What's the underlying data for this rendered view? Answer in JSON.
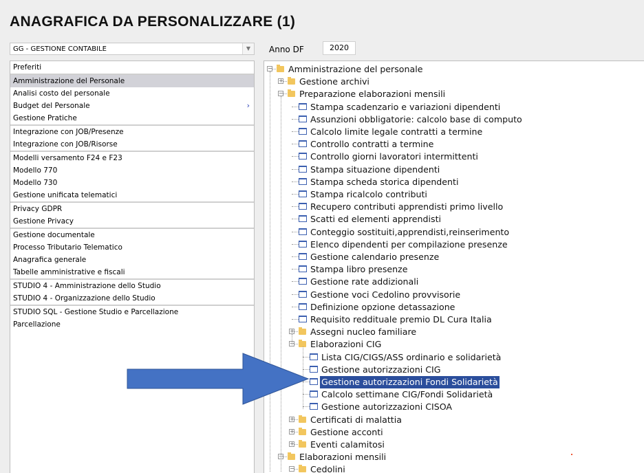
{
  "page": {
    "title": "ANAGRAFICA DA PERSONALIZZARE (1)"
  },
  "module_select": {
    "value": "GG - GESTIONE CONTABILE",
    "arrow_icon": "chevron-down-icon"
  },
  "year": {
    "label": "Anno DF",
    "value": "2020"
  },
  "menu": [
    {
      "label": "Preferiti",
      "sep": false,
      "selected": false,
      "chevron": false
    },
    {
      "label": "Amministrazione del Personale",
      "sep": true,
      "selected": true,
      "chevron": false
    },
    {
      "label": "Analisi costo del personale",
      "sep": false,
      "selected": false,
      "chevron": false
    },
    {
      "label": "Budget del Personale",
      "sep": false,
      "selected": false,
      "chevron": true
    },
    {
      "label": "Gestione Pratiche",
      "sep": false,
      "selected": false,
      "chevron": false
    },
    {
      "label": "Integrazione con JOB/Presenze",
      "sep": true,
      "selected": false,
      "chevron": false
    },
    {
      "label": "Integrazione con JOB/Risorse",
      "sep": false,
      "selected": false,
      "chevron": false
    },
    {
      "label": "Modelli versamento F24 e F23",
      "sep": true,
      "selected": false,
      "chevron": false
    },
    {
      "label": "Modello 770",
      "sep": false,
      "selected": false,
      "chevron": false
    },
    {
      "label": "Modello 730",
      "sep": false,
      "selected": false,
      "chevron": false
    },
    {
      "label": "Gestione unificata telematici",
      "sep": false,
      "selected": false,
      "chevron": false
    },
    {
      "label": "Privacy GDPR",
      "sep": true,
      "selected": false,
      "chevron": false
    },
    {
      "label": "Gestione Privacy",
      "sep": false,
      "selected": false,
      "chevron": false
    },
    {
      "label": "Gestione documentale",
      "sep": true,
      "selected": false,
      "chevron": false
    },
    {
      "label": "Processo Tributario Telematico",
      "sep": false,
      "selected": false,
      "chevron": false
    },
    {
      "label": "Anagrafica generale",
      "sep": false,
      "selected": false,
      "chevron": false
    },
    {
      "label": "Tabelle amministrative e fiscali",
      "sep": false,
      "selected": false,
      "chevron": false
    },
    {
      "label": "STUDIO 4 - Amministrazione dello Studio",
      "sep": true,
      "selected": false,
      "chevron": false
    },
    {
      "label": "STUDIO 4 - Organizzazione dello Studio",
      "sep": false,
      "selected": false,
      "chevron": false
    },
    {
      "label": "STUDIO SQL - Gestione Studio e Parcellazione",
      "sep": true,
      "selected": false,
      "chevron": false
    },
    {
      "label": "Parcellazione",
      "sep": false,
      "selected": false,
      "chevron": false
    }
  ],
  "tree": [
    {
      "label": "Amministrazione del personale",
      "level": 0,
      "kind": "folder",
      "expander": "-"
    },
    {
      "label": "Gestione archivi",
      "level": 1,
      "kind": "folder",
      "expander": "+"
    },
    {
      "label": "Preparazione elaborazioni mensili",
      "level": 1,
      "kind": "folder",
      "expander": "-"
    },
    {
      "label": "Stampa scadenzario e variazioni dipendenti",
      "level": 2,
      "kind": "doc"
    },
    {
      "label": "Assunzioni obbligatorie: calcolo base di computo",
      "level": 2,
      "kind": "doc"
    },
    {
      "label": "Calcolo limite legale contratti a termine",
      "level": 2,
      "kind": "doc"
    },
    {
      "label": "Controllo contratti a termine",
      "level": 2,
      "kind": "doc"
    },
    {
      "label": "Controllo giorni lavoratori intermittenti",
      "level": 2,
      "kind": "doc"
    },
    {
      "label": "Stampa situazione dipendenti",
      "level": 2,
      "kind": "doc"
    },
    {
      "label": "Stampa scheda storica dipendenti",
      "level": 2,
      "kind": "doc"
    },
    {
      "label": "Stampa ricalcolo contributi",
      "level": 2,
      "kind": "doc"
    },
    {
      "label": "Recupero contributi apprendisti primo livello",
      "level": 2,
      "kind": "doc"
    },
    {
      "label": "Scatti ed elementi apprendisti",
      "level": 2,
      "kind": "doc"
    },
    {
      "label": "Conteggio sostituiti,apprendisti,reinserimento",
      "level": 2,
      "kind": "doc"
    },
    {
      "label": "Elenco dipendenti per compilazione presenze",
      "level": 2,
      "kind": "doc"
    },
    {
      "label": "Gestione calendario presenze",
      "level": 2,
      "kind": "doc"
    },
    {
      "label": "Stampa libro presenze",
      "level": 2,
      "kind": "doc"
    },
    {
      "label": "Gestione rate addizionali",
      "level": 2,
      "kind": "doc"
    },
    {
      "label": "Gestione voci Cedolino provvisorie",
      "level": 2,
      "kind": "doc"
    },
    {
      "label": "Definizione opzione detassazione",
      "level": 2,
      "kind": "doc"
    },
    {
      "label": "Requisito reddituale premio DL Cura Italia",
      "level": 2,
      "kind": "doc"
    },
    {
      "label": "Assegni nucleo familiare",
      "level": 2,
      "kind": "folder",
      "expander": "+"
    },
    {
      "label": "Elaborazioni CIG",
      "level": 2,
      "kind": "folder",
      "expander": "-"
    },
    {
      "label": "Lista CIG/CIGS/ASS ordinario e solidarietà",
      "level": 3,
      "kind": "doc"
    },
    {
      "label": "Gestione autorizzazioni CIG",
      "level": 3,
      "kind": "doc"
    },
    {
      "label": "Gestione autorizzazioni Fondi Solidarietà",
      "level": 3,
      "kind": "doc",
      "selected": true
    },
    {
      "label": "Calcolo settimane CIG/Fondi Solidarietà",
      "level": 3,
      "kind": "doc"
    },
    {
      "label": "Gestione autorizzazioni CISOA",
      "level": 3,
      "kind": "doc"
    },
    {
      "label": "Certificati di malattia",
      "level": 2,
      "kind": "folder",
      "expander": "+"
    },
    {
      "label": "Gestione acconti",
      "level": 2,
      "kind": "folder",
      "expander": "+"
    },
    {
      "label": "Eventi calamitosi",
      "level": 2,
      "kind": "folder",
      "expander": "+"
    },
    {
      "label": "Elaborazioni mensili",
      "level": 1,
      "kind": "folder",
      "expander": "-"
    },
    {
      "label": "Cedolini",
      "level": 2,
      "kind": "folder",
      "expander": "-"
    }
  ],
  "colors": {
    "selection": "#2b4e9c",
    "menu_selected": "#d2d2d8",
    "arrow": "#4472c4",
    "folder": "#f2c65e"
  }
}
